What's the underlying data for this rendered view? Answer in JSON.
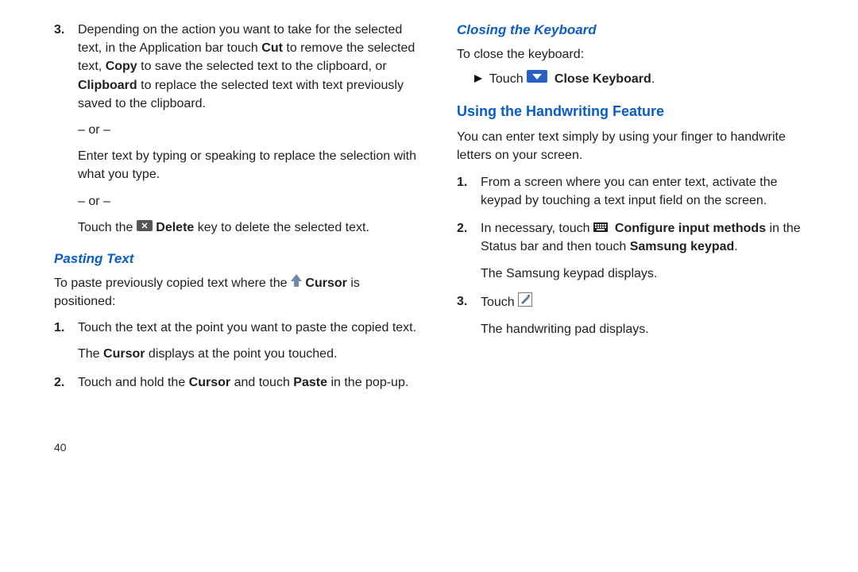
{
  "left": {
    "item3": {
      "num": "3.",
      "p1a": "Depending on the action you want to take for the selected text, in the Application bar touch ",
      "cut": "Cut",
      "p1b": " to remove the selected text, ",
      "copy": "Copy",
      "p1c": " to save the selected text to the clipboard, or ",
      "clipboard": "Clipboard",
      "p1d": " to replace the selected text with text previously saved to the clipboard.",
      "or1": "– or –",
      "p2": "Enter text by typing or speaking to replace the selection with what you type.",
      "or2": "– or –",
      "p3a": "Touch the ",
      "delete": "Delete",
      "p3b": " key to delete the selected text."
    },
    "pasting_heading": "Pasting Text",
    "pasting_intro_a": "To paste previously copied text where the ",
    "cursor": "Cursor",
    "pasting_intro_b": " is positioned:",
    "paste1": {
      "num": "1.",
      "p1": "Touch the text at the point you want to paste the copied text.",
      "p2a": "The ",
      "p2b": " displays at the point you touched."
    },
    "paste2": {
      "num": "2.",
      "a": "Touch and hold the ",
      "b": " and touch ",
      "paste": "Paste",
      "c": " in the pop-up."
    },
    "page_num": "40"
  },
  "right": {
    "closing_heading": "Closing the Keyboard",
    "closing_intro": "To close the keyboard:",
    "closing_touch": "Touch ",
    "close_kbd": "Close Keyboard",
    "period": ".",
    "hand_heading": "Using the Handwriting Feature",
    "hand_intro": "You can enter text simply by using your finger to handwrite letters on your screen.",
    "h1": {
      "num": "1.",
      "text": "From a screen where you can enter text, activate the keypad by touching a text input field on the screen."
    },
    "h2": {
      "num": "2.",
      "a": "In necessary, touch ",
      "cfg": "Configure input methods",
      "b": " in the Status bar and then touch ",
      "skp": "Samsung keypad",
      "c": ".",
      "sub": "The Samsung keypad displays."
    },
    "h3": {
      "num": "3.",
      "a": "Touch ",
      "sub": "The handwriting pad displays."
    }
  }
}
